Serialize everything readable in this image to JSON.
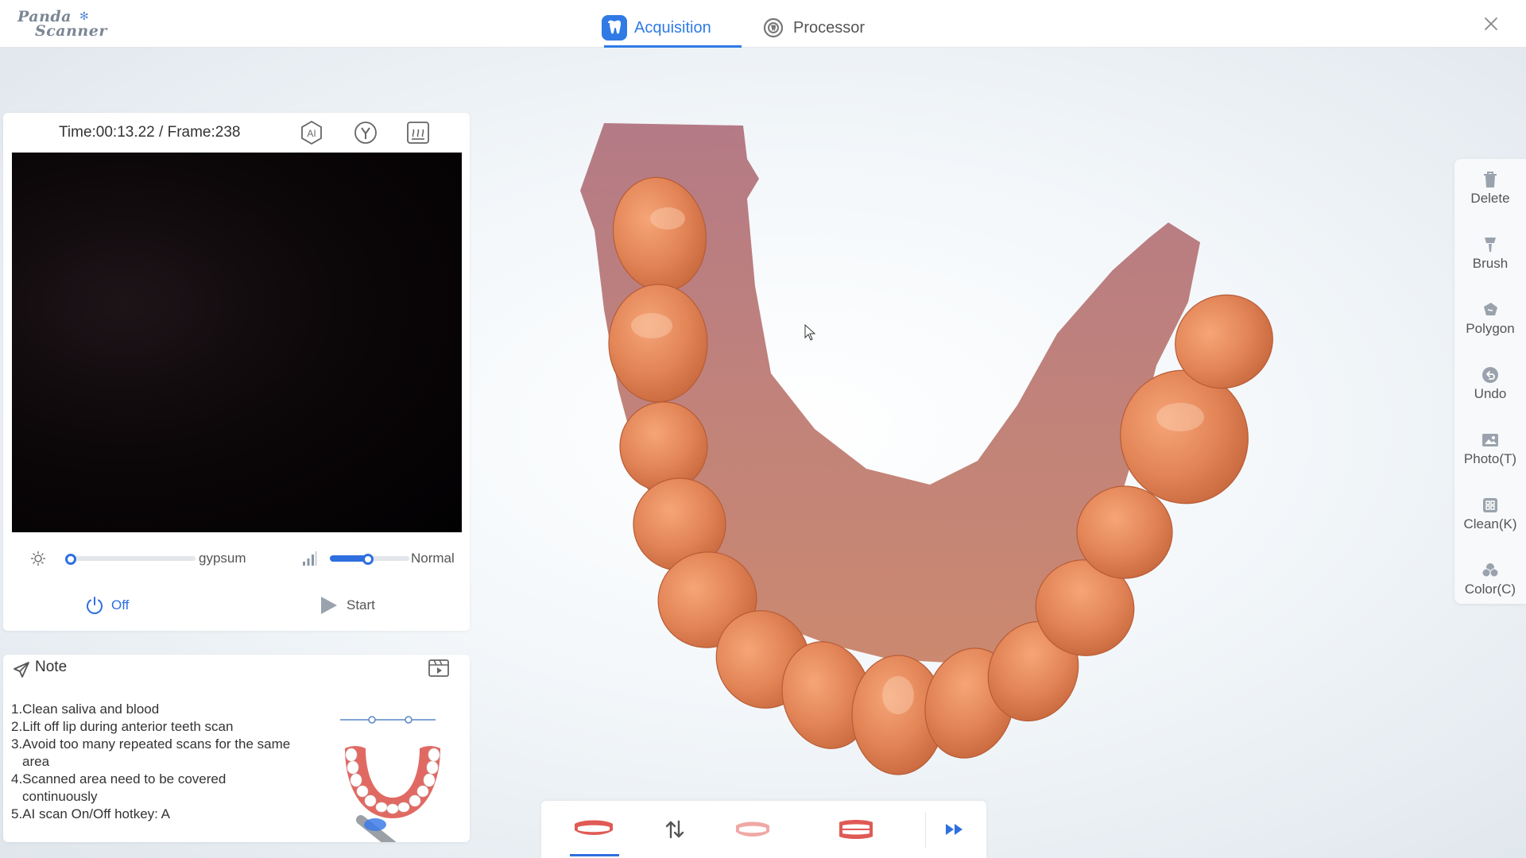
{
  "app": {
    "logo_line1": "Panda",
    "logo_line2": "Scanner"
  },
  "tabs": [
    {
      "label": "Acquisition",
      "active": true
    },
    {
      "label": "Processor",
      "active": false
    }
  ],
  "camera": {
    "time_frame": "Time:00:13.22 / Frame:238",
    "header_icons": [
      "ai-scan-icon",
      "y-mode-icon",
      "heating-icon"
    ],
    "brightness": {
      "icon": "brightness-icon",
      "label": "gypsum",
      "level": 0
    },
    "quality": {
      "icon": "signal-icon",
      "label": "Normal",
      "level": 0.5
    },
    "power": {
      "label": "Off",
      "icon": "power-icon"
    },
    "start": {
      "label": "Start",
      "icon": "play-icon"
    }
  },
  "note": {
    "title": "Note",
    "items": [
      "1.Clean saliva and blood",
      "2.Lift off lip during anterior teeth scan",
      "3.Avoid too many repeated scans for the same area",
      "4.Scanned area need to be covered continuously",
      "5.AI scan On/Off hotkey: A"
    ]
  },
  "toolbar": [
    {
      "label": "Delete",
      "icon": "trash-icon"
    },
    {
      "label": "Brush",
      "icon": "brush-icon"
    },
    {
      "label": "Polygon",
      "icon": "polygon-icon"
    },
    {
      "label": "Undo",
      "icon": "undo-icon"
    },
    {
      "label": "Photo(T)",
      "icon": "photo-icon"
    },
    {
      "label": "Clean(K)",
      "icon": "clean-icon"
    },
    {
      "label": "Color(C)",
      "icon": "color-icon"
    }
  ],
  "bottom_bar": {
    "buttons": [
      "upper-jaw-icon",
      "swap-jaws-icon",
      "lower-jaw-icon",
      "bite-icon",
      "fast-forward-icon"
    ],
    "active_index": 0
  },
  "colors": {
    "accent": "#2f7ae5",
    "tooth": "#e8875e",
    "gum": "#a8707e"
  }
}
